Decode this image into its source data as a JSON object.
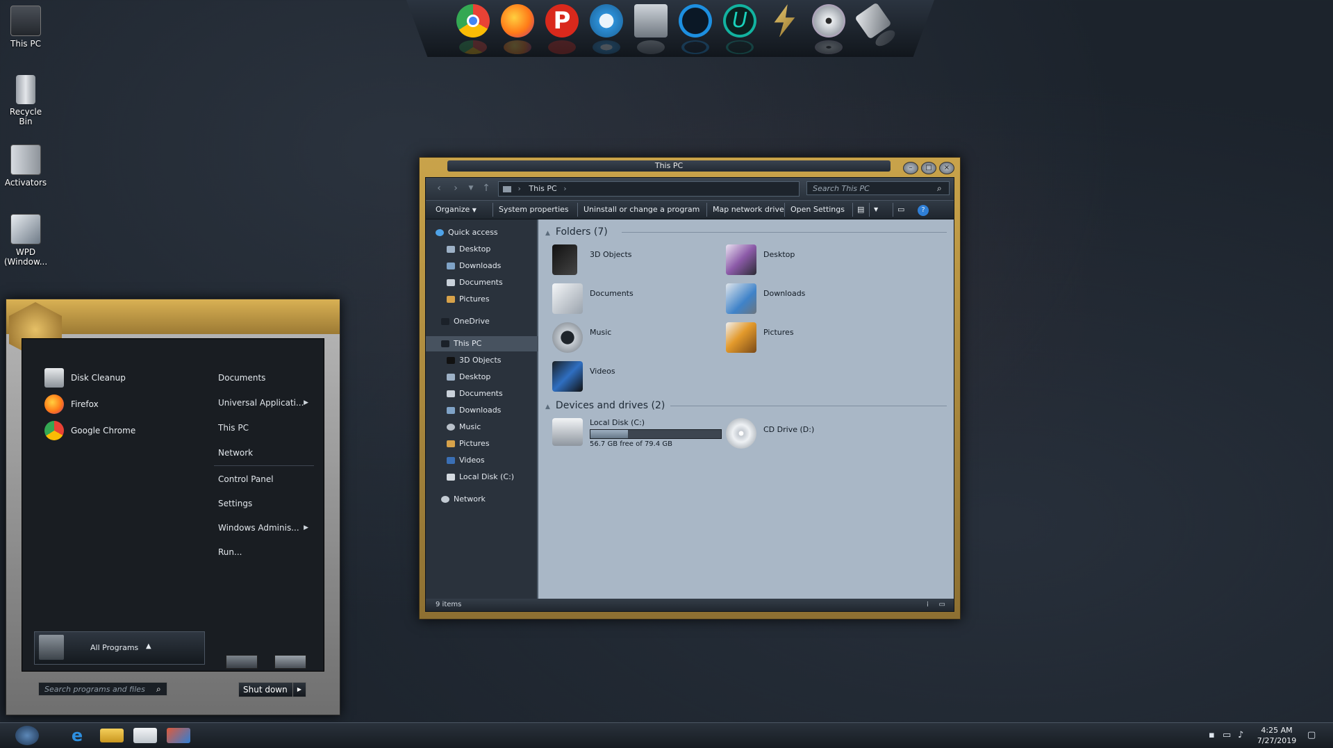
{
  "desktop": {
    "icons": [
      {
        "label": "This PC",
        "icon": "computer-icon"
      },
      {
        "label": "Recycle Bin",
        "icon": "recycle-bin-icon"
      },
      {
        "label": "Activators",
        "icon": "folder-icon"
      },
      {
        "label": "WPD (Window...",
        "icon": "app-icon"
      }
    ]
  },
  "dock": {
    "items": [
      {
        "name": "chrome",
        "icon": "chrome-icon",
        "color": "#e94235"
      },
      {
        "name": "firefox",
        "icon": "firefox-icon",
        "color": "#ff7a18"
      },
      {
        "name": "psiphon",
        "icon": "psiphon-icon",
        "color": "#d9291c"
      },
      {
        "name": "settings",
        "icon": "gear-icon",
        "color": "#2c8fd6"
      },
      {
        "name": "monitor",
        "icon": "monitor-icon",
        "color": "#9aa3ad"
      },
      {
        "name": "app-grid",
        "icon": "grid-icon",
        "color": "#1d8fe0"
      },
      {
        "name": "uplay",
        "icon": "u-icon",
        "color": "#12b3a0"
      },
      {
        "name": "winamp",
        "icon": "bolt-icon",
        "color": "#c9a43a"
      },
      {
        "name": "dvd",
        "icon": "disc-icon",
        "color": "#c7ccd2"
      },
      {
        "name": "usb",
        "icon": "usb-drive-icon",
        "color": "#9aa0a7"
      }
    ]
  },
  "explorer": {
    "title": "This PC",
    "breadcrumb": [
      "This PC"
    ],
    "search_placeholder": "Search This PC",
    "commands": [
      "Organize",
      "System properties",
      "Uninstall or change a program",
      "Map network drive",
      "Open Settings"
    ],
    "nav": {
      "quick_access": "Quick access",
      "quick_items": [
        "Desktop",
        "Downloads",
        "Documents",
        "Pictures"
      ],
      "onedrive": "OneDrive",
      "this_pc": "This PC",
      "pc_items": [
        "3D Objects",
        "Desktop",
        "Documents",
        "Downloads",
        "Music",
        "Pictures",
        "Videos",
        "Local Disk (C:)"
      ],
      "network": "Network"
    },
    "folders_header": "Folders (7)",
    "folders": [
      "3D Objects",
      "Desktop",
      "Documents",
      "Downloads",
      "Music",
      "Pictures",
      "Videos"
    ],
    "drives_header": "Devices and drives (2)",
    "drives": [
      {
        "name": "Local Disk (C:)",
        "free": "56.7 GB free of 79.4 GB",
        "used_fraction": 0.286
      },
      {
        "name": "CD Drive (D:)"
      }
    ],
    "status": "9 items"
  },
  "start_menu": {
    "programs": [
      "Disk Cleanup",
      "Firefox",
      "Google Chrome"
    ],
    "places": [
      {
        "label": "Documents",
        "arrow": false
      },
      {
        "label": "Universal Applicati...",
        "arrow": true
      },
      {
        "label": "This PC",
        "arrow": false
      },
      {
        "label": "Network",
        "arrow": false
      },
      {
        "label": "Control Panel",
        "arrow": false
      },
      {
        "label": "Settings",
        "arrow": false
      },
      {
        "label": "Windows Adminis...",
        "arrow": true
      },
      {
        "label": "Run...",
        "arrow": false
      }
    ],
    "all_programs": "All Programs",
    "search_placeholder": "Search programs and files",
    "shutdown": "Shut down"
  },
  "taskbar": {
    "time": "4:25 AM",
    "date": "7/27/2019"
  }
}
